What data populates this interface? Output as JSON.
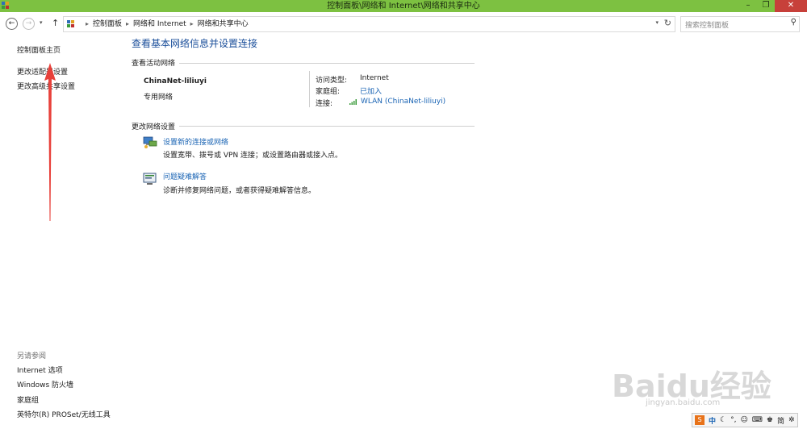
{
  "window": {
    "title": "控制面板\\网络和 Internet\\网络和共享中心",
    "minimize": "–",
    "restore": "❐",
    "close": "✕"
  },
  "nav": {
    "back": "←",
    "forward": "→",
    "up": "↑",
    "breadcrumbs": [
      "控制面板",
      "网络和 Internet",
      "网络和共享中心"
    ],
    "separator": "▸",
    "search_placeholder": "搜索控制面板"
  },
  "sidebar": {
    "items": [
      "控制面板主页",
      "更改适配器设置",
      "更改高级共享设置"
    ],
    "see_also_header": "另请参阅",
    "see_also": [
      "Internet 选项",
      "Windows 防火墙",
      "家庭组",
      "英特尔(R) PROSet/无线工具"
    ]
  },
  "main": {
    "title": "查看基本网络信息并设置连接",
    "active_networks_header": "查看活动网络",
    "network": {
      "name": "ChinaNet-liliuyi",
      "type": "专用网络",
      "access_type_label": "访问类型:",
      "access_type_value": "Internet",
      "homegroup_label": "家庭组:",
      "homegroup_value": "已加入",
      "connection_label": "连接:",
      "connection_value": "WLAN (ChinaNet-liliuyi)"
    },
    "change_settings_header": "更改网络设置",
    "tasks": [
      {
        "title": "设置新的连接或网络",
        "desc": "设置宽带、拨号或 VPN 连接；或设置路由器或接入点。"
      },
      {
        "title": "问题疑难解答",
        "desc": "诊断并修复网络问题，或者获得疑难解答信息。"
      }
    ]
  },
  "watermark": {
    "brand": "Baidu经验",
    "url": "jingyan.baidu.com"
  },
  "ime": {
    "logo": "S",
    "lang": "中",
    "simp": "简"
  },
  "colors": {
    "titlebar": "#7dc141",
    "link": "#1a64b4",
    "close_button": "#c7403a",
    "arrow": "#e8403a"
  }
}
